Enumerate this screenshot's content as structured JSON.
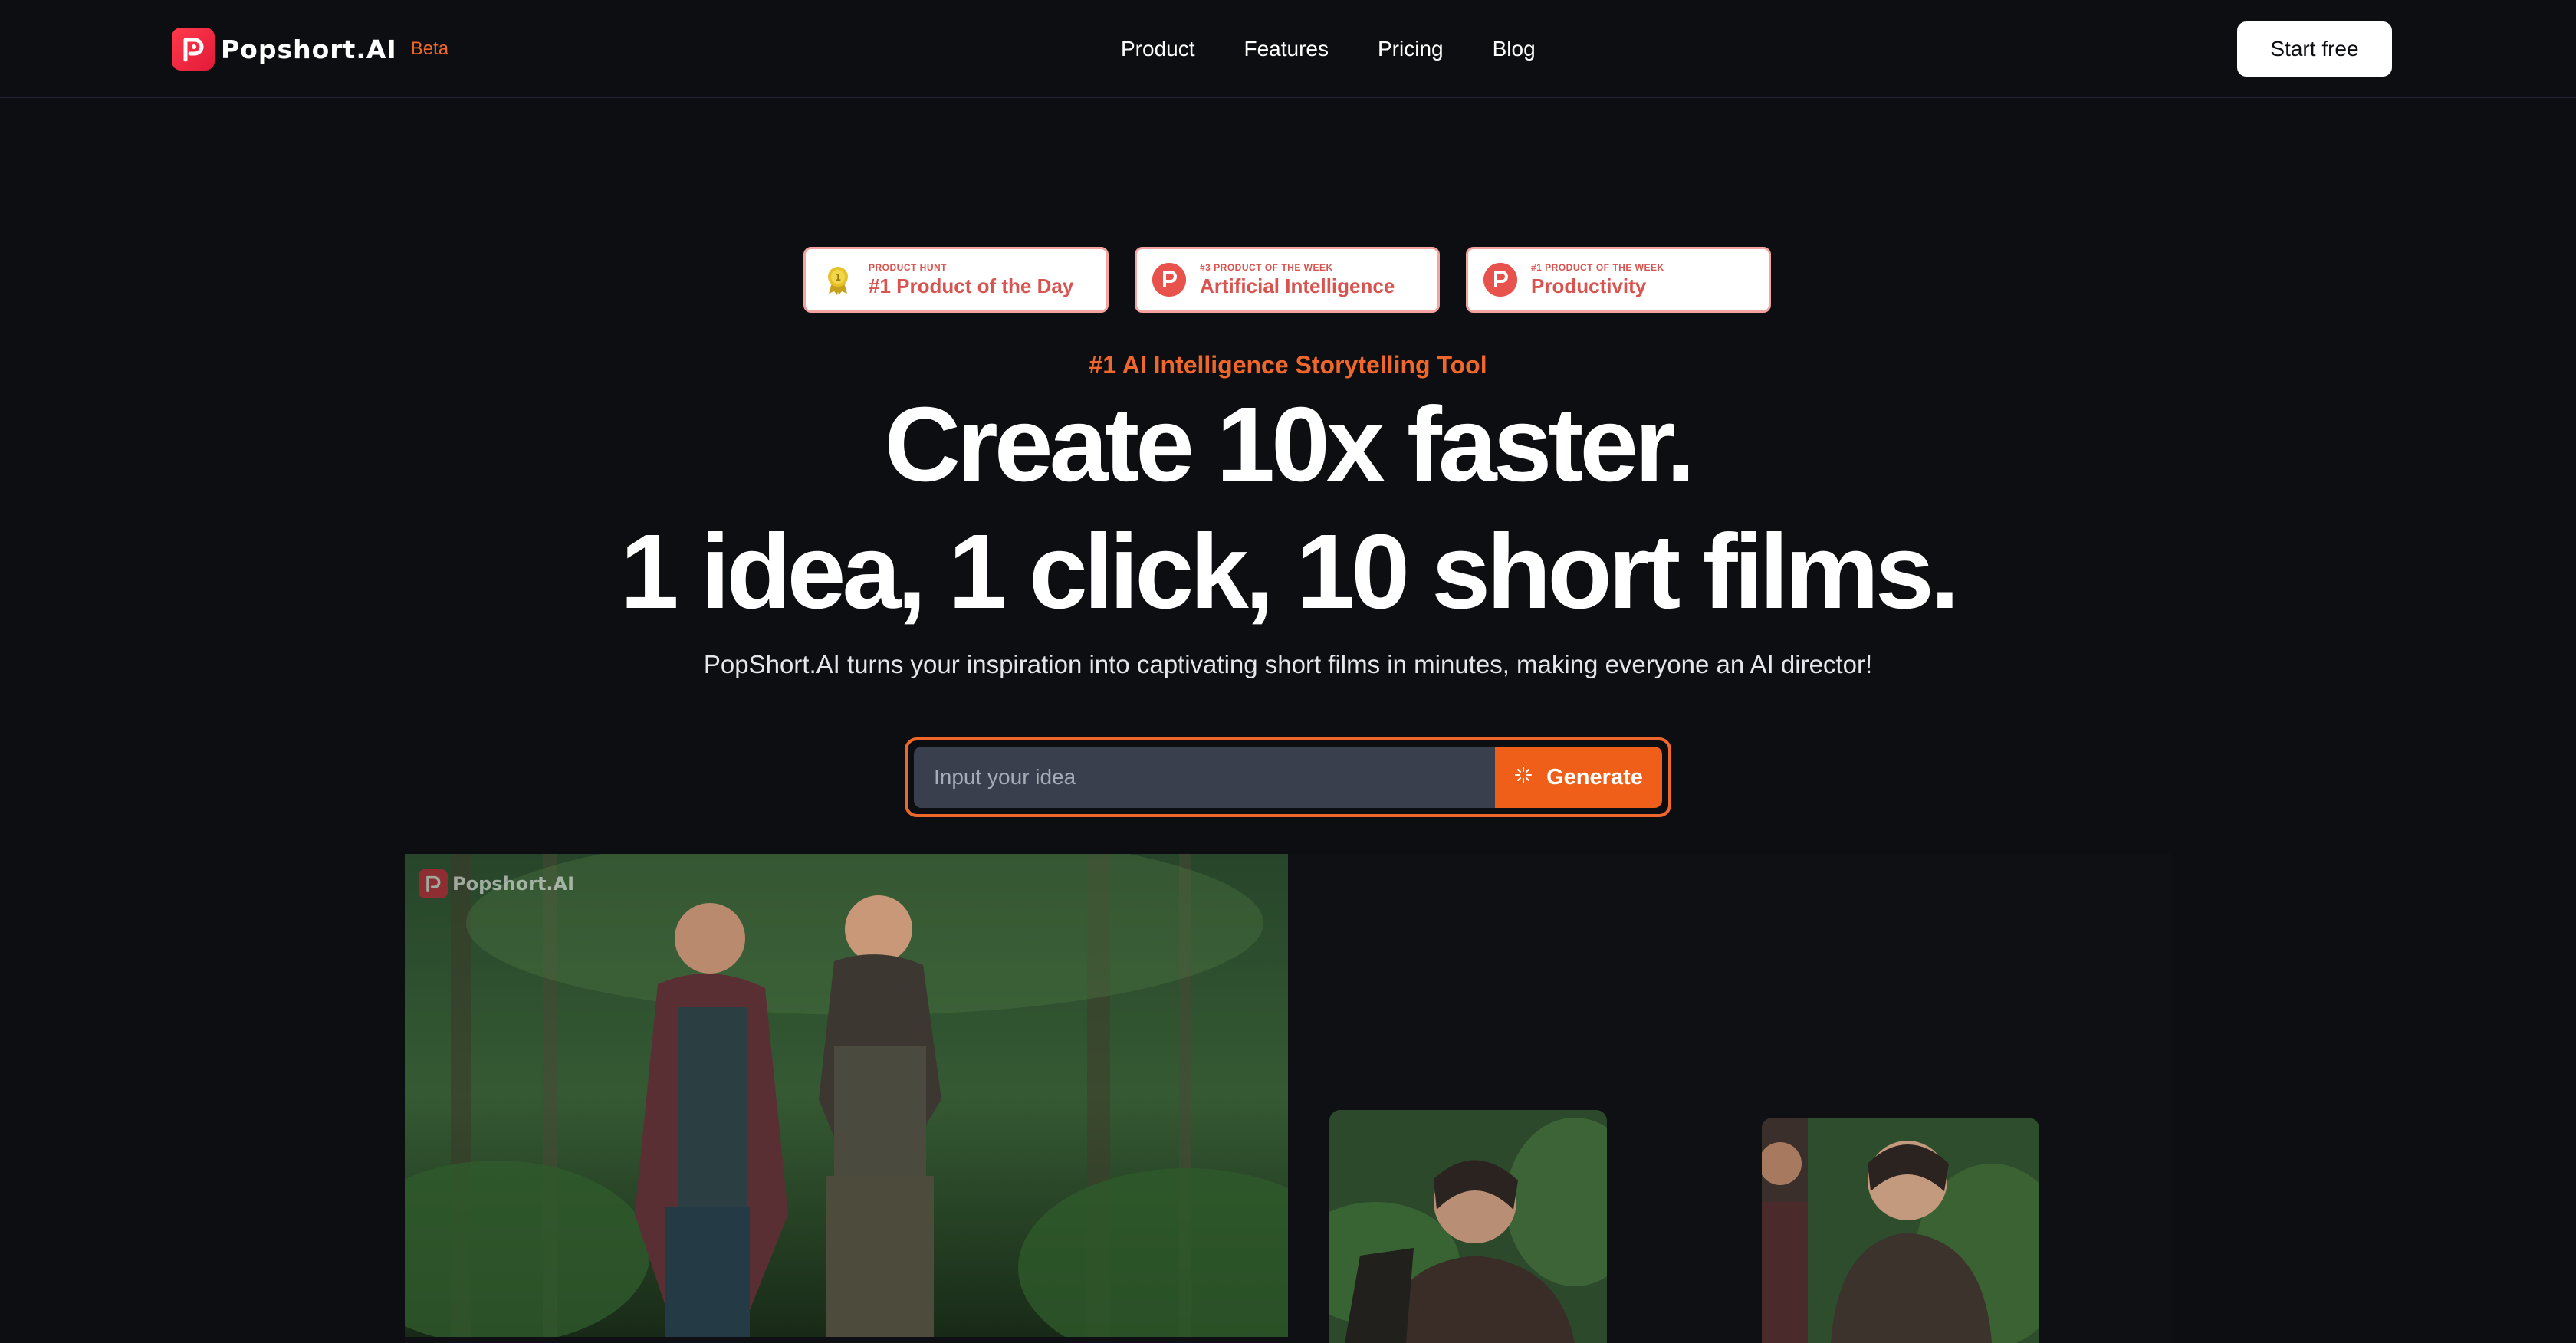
{
  "header": {
    "brand_name": "Popshort.AI",
    "brand_tag": "Beta",
    "nav": [
      "Product",
      "Features",
      "Pricing",
      "Blog"
    ],
    "cta": "Start free"
  },
  "badges": [
    {
      "small": "PRODUCT HUNT",
      "big": "#1 Product of the Day",
      "icon": "medal-icon"
    },
    {
      "small": "#3 PRODUCT OF THE WEEK",
      "big": "Artificial Intelligence",
      "icon": "producthunt-icon"
    },
    {
      "small": "#1 PRODUCT OF THE WEEK",
      "big": "Productivity",
      "icon": "producthunt-icon"
    }
  ],
  "hero": {
    "tagline": "#1 AI Intelligence Storytelling Tool",
    "headline_1": "Create 10x faster.",
    "headline_2": "1 idea, 1 click, 10 short films.",
    "subtitle": "PopShort.AI turns your inspiration into captivating short films in minutes, making everyone an AI director!"
  },
  "idea": {
    "placeholder": "Input your idea",
    "value": "",
    "button": "Generate"
  },
  "media": {
    "watermark": "Popshort.AI"
  },
  "colors": {
    "accent": "#f0672b",
    "background": "#0d0e12",
    "badge_text": "#d9534f"
  }
}
